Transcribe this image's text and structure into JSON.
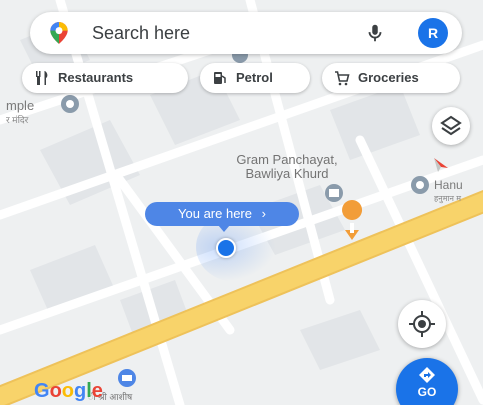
{
  "search": {
    "placeholder": "Search here",
    "avatar_initial": "R",
    "icons": [
      "maps-pin-icon",
      "mic-icon"
    ]
  },
  "chips": [
    {
      "label": "Restaurants",
      "icon": "fork-knife-icon"
    },
    {
      "label": "Petrol",
      "icon": "fuel-pump-icon"
    },
    {
      "label": "Groceries",
      "icon": "cart-icon"
    }
  ],
  "map": {
    "labels": {
      "temple": "mple",
      "temple_sub": "र मंदिर",
      "gram_panchayat_line1": "Gram Panchayat,",
      "gram_panchayat_line2": "Bawliya Khurd",
      "hanuman": "Hanu",
      "hanuman_sub": "हनुमान म",
      "bottom_hindi": "ी श्री आशीष"
    },
    "colors": {
      "land": "#eef0f1",
      "road_minor": "#ffffff",
      "road_major": "#f8d36a",
      "road_major_edge": "#eec25a",
      "poi_gray": "#8a9bab",
      "poi_orange": "#f29d38",
      "poi_blue": "#4e86e6"
    }
  },
  "you_are_here": {
    "label": "You are here",
    "chevron": "›"
  },
  "controls": {
    "layers": "layers-icon",
    "compass": "compass-icon",
    "locate": "my-location-icon",
    "go_label": "GO"
  },
  "attribution": {
    "letters": [
      {
        "ch": "G",
        "color": "#4285f4"
      },
      {
        "ch": "o",
        "color": "#ea4335"
      },
      {
        "ch": "o",
        "color": "#fbbc05"
      },
      {
        "ch": "g",
        "color": "#4285f4"
      },
      {
        "ch": "l",
        "color": "#34a853"
      },
      {
        "ch": "e",
        "color": "#ea4335"
      }
    ]
  }
}
